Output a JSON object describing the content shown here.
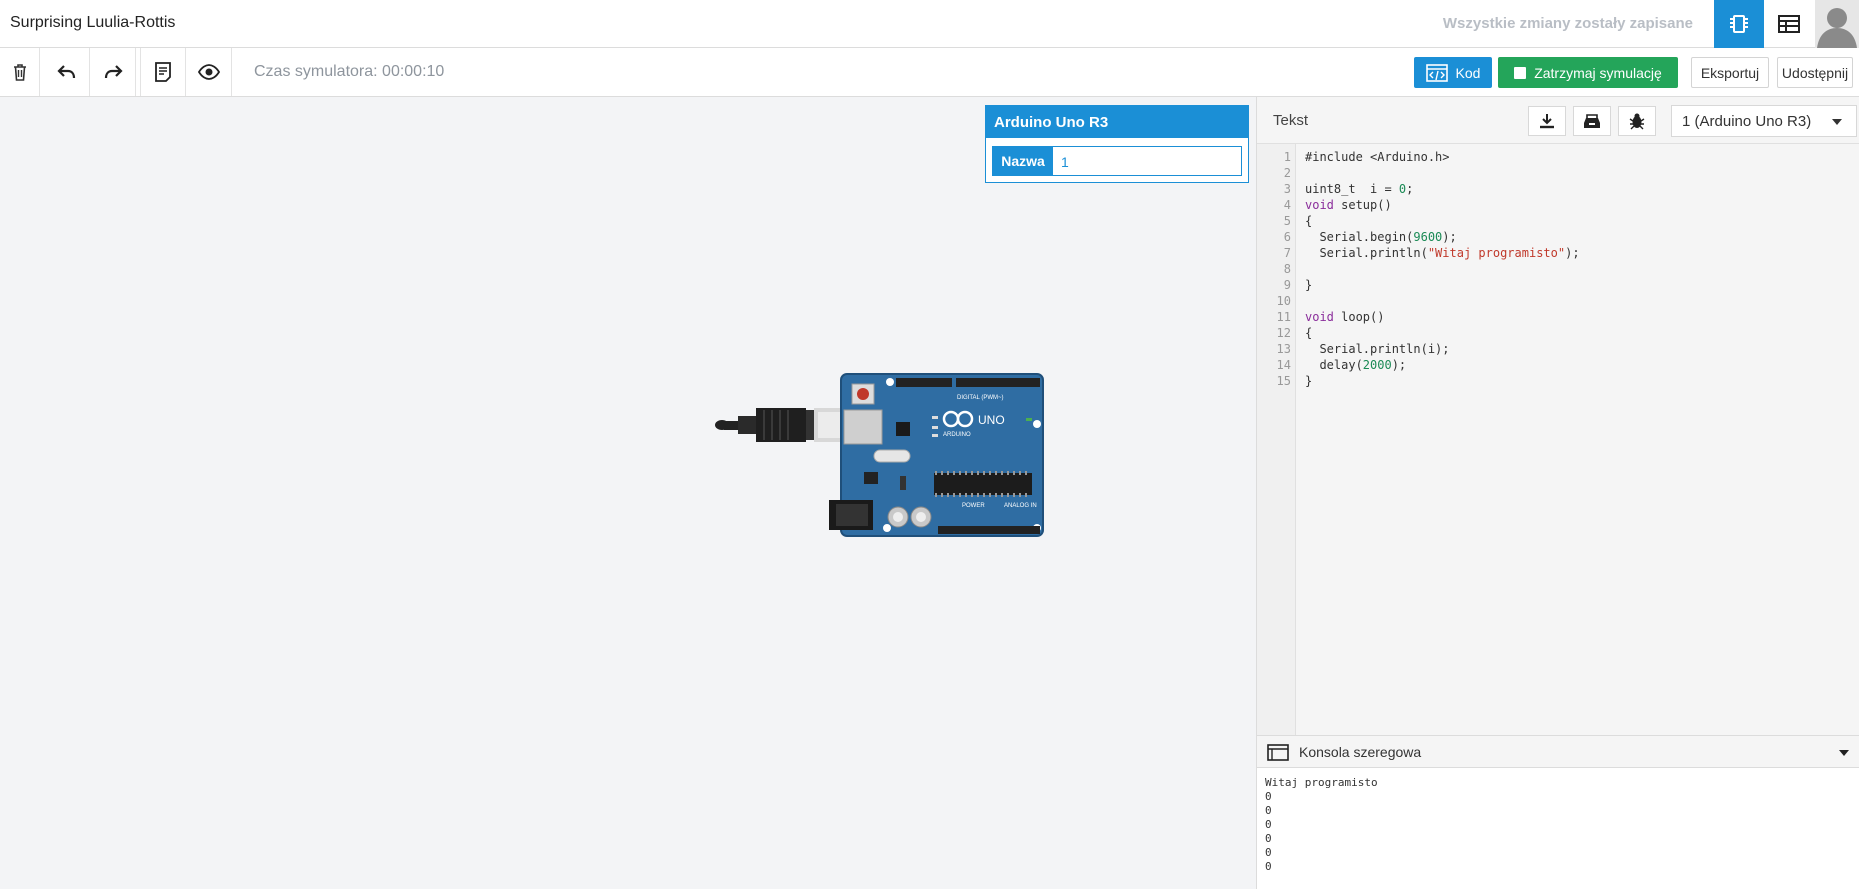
{
  "header": {
    "title": "Surprising Luulia-Rottis",
    "saved_status": "Wszystkie zmiany zostały zapisane"
  },
  "toolbar": {
    "timer": "Czas symulatora: 00:00:10",
    "code_label": "Kod",
    "stop_label": "Zatrzymaj symulację",
    "export_label": "Eksportuj",
    "share_label": "Udostępnij"
  },
  "inspector": {
    "title": "Arduino Uno R3",
    "name_label": "Nazwa",
    "name_value": "1"
  },
  "board": {
    "brand": "ARDUINO",
    "model": "UNO",
    "digital_label": "DIGITAL (PWM~)",
    "power_label": "POWER",
    "analog_label": "ANALOG IN"
  },
  "code_panel": {
    "mode_label": "Tekst",
    "device_select": "1 (Arduino Uno R3)",
    "line_numbers": [
      "1",
      "2",
      "3",
      "4",
      "5",
      "6",
      "7",
      "8",
      "9",
      "10",
      "11",
      "12",
      "13",
      "14",
      "15"
    ]
  },
  "serial": {
    "title": "Konsola szeregowa",
    "output": "Witaj programisto\n0\n0\n0\n0\n0\n0"
  },
  "colors": {
    "accent": "#1b8fd6",
    "stop": "#24a55a",
    "board": "#2f6da3"
  }
}
